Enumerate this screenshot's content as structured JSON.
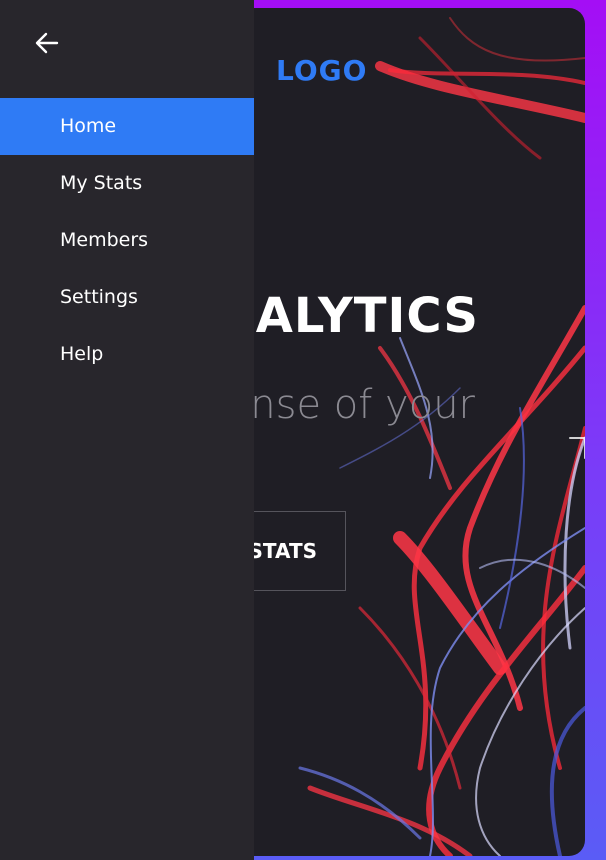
{
  "header": {
    "logo": "LOGO"
  },
  "hero": {
    "title": "ANALYTICS",
    "subtitle": "Make sense of your",
    "button_label": "MY STATS"
  },
  "drawer": {
    "back_icon": "arrow-left-icon",
    "items": [
      {
        "label": "Home",
        "active": true
      },
      {
        "label": "My Stats",
        "active": false
      },
      {
        "label": "Members",
        "active": false
      },
      {
        "label": "Settings",
        "active": false
      },
      {
        "label": "Help",
        "active": false
      }
    ]
  },
  "colors": {
    "accent": "#2f7bf5",
    "drawer_bg": "#28262c",
    "card_bg": "#1f1e25",
    "frame_gradient_top": "#a40ef5",
    "frame_gradient_bottom": "#5a5cf6"
  }
}
